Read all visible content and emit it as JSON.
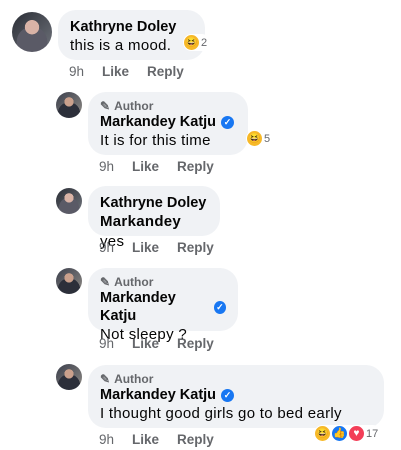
{
  "comments": [
    {
      "author": "Kathryne Doley",
      "text": "this is a mood.",
      "time": "9h",
      "like": "Like",
      "reply": "Reply",
      "reaction_count": "2"
    },
    {
      "badge": "Author",
      "author": "Markandey Katju",
      "text": "It is for this time",
      "time": "9h",
      "like": "Like",
      "reply": "Reply",
      "reaction_count": "5"
    },
    {
      "author": "Kathryne Doley",
      "mention": "Markandey",
      "text": " yes",
      "time": "9h",
      "like": "Like",
      "reply": "Reply"
    },
    {
      "badge": "Author",
      "author": "Markandey Katju",
      "text": "Not sleepy ?",
      "time": "9h",
      "like": "Like",
      "reply": "Reply"
    },
    {
      "badge": "Author",
      "author": "Markandey Katju",
      "text": "I thought good girls go to bed early",
      "time": "9h",
      "like": "Like",
      "reply": "Reply",
      "reaction_count": "17"
    }
  ],
  "icons": {
    "author_badge": "pencil-icon",
    "verified": "verified-checkmark-icon",
    "reactions": [
      "haha-emoji-icon",
      "like-icon",
      "love-icon"
    ]
  },
  "colors": {
    "bubble": "#f0f2f5",
    "meta_text": "#65676b",
    "verified": "#1877f2"
  }
}
